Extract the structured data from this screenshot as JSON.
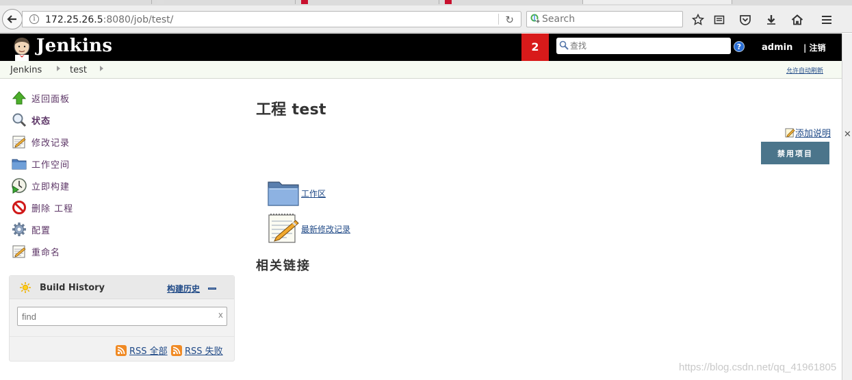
{
  "browser": {
    "url_host": "172.25.26.5",
    "url_rest": ":8080/job/test/",
    "search_placeholder": "Search"
  },
  "header": {
    "logo": "Jenkins",
    "notifications": "2",
    "search_placeholder": "查找",
    "help": "?",
    "user": "admin",
    "logout": "| 注销"
  },
  "breadcrumbs": {
    "items": [
      "Jenkins",
      "test"
    ],
    "auto_refresh": "允许自动刷新"
  },
  "sidebar": {
    "tasks": [
      {
        "label": "返回面板",
        "icon": "up-arrow-icon"
      },
      {
        "label": "状态",
        "icon": "magnifier-icon"
      },
      {
        "label": "修改记录",
        "icon": "notepad-icon"
      },
      {
        "label": "工作空间",
        "icon": "folder-icon"
      },
      {
        "label": "立即构建",
        "icon": "clock-play-icon"
      },
      {
        "label": "删除 工程",
        "icon": "no-entry-icon"
      },
      {
        "label": "配置",
        "icon": "gear-icon"
      },
      {
        "label": "重命名",
        "icon": "notepad-icon"
      }
    ]
  },
  "build_history": {
    "title": "Build History",
    "trend_label": "构建历史",
    "find_placeholder": "find",
    "clear": "x",
    "rss_all": "RSS 全部",
    "rss_failures": "RSS 失败"
  },
  "main": {
    "title": "工程 test",
    "add_description": "添加说明",
    "disable_button": "禁用项目",
    "links": [
      {
        "label": "工作区",
        "icon": "folder-icon"
      },
      {
        "label": "最新修改记录",
        "icon": "notepad-icon"
      }
    ],
    "related_links": "相关链接"
  },
  "watermark": "https://blog.csdn.net/qq_41961805",
  "colors": {
    "header_bg": "#000000",
    "notification_red": "#d81a1a",
    "link_blue": "#204a87",
    "task_purple": "#5c3566",
    "button_bg": "#4b758b"
  }
}
